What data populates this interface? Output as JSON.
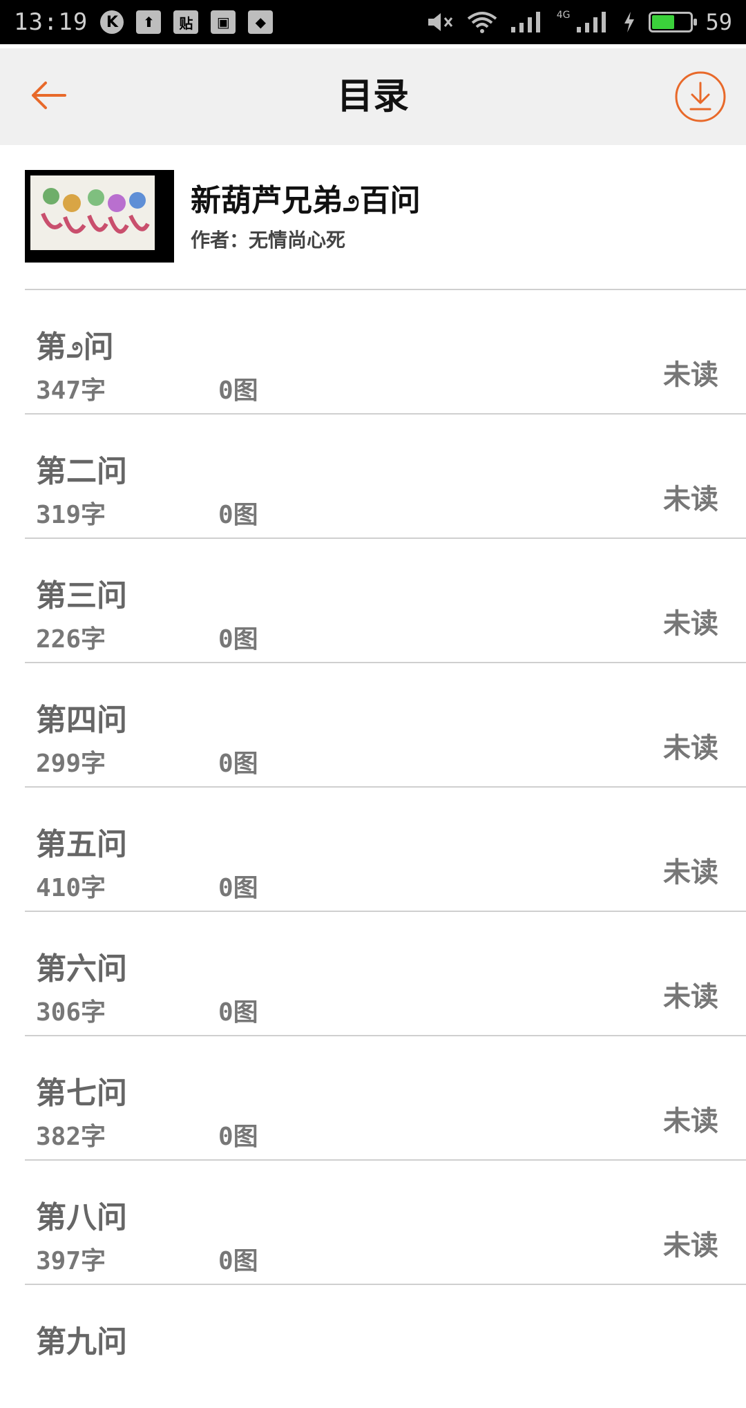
{
  "status_bar": {
    "time": "13:19",
    "icons": [
      "k-icon",
      "upload-icon",
      "tie-icon",
      "image-icon",
      "qq-icon",
      "mute-icon",
      "wifi-icon",
      "signal-icon",
      "signal-4g-icon",
      "charging-icon"
    ],
    "k_label": "K",
    "tie_label": "贴",
    "network_label": "4G",
    "battery_level": 59,
    "battery_text": "59"
  },
  "header": {
    "title": "目录",
    "accent_color": "#e8692a"
  },
  "book": {
    "title": "新葫芦兄弟೨百问",
    "author": "作者：无情尚心死"
  },
  "chapters": [
    {
      "title": "第೨问",
      "words": "347字",
      "images": "0图",
      "status": "未读"
    },
    {
      "title": "第二问",
      "words": "319字",
      "images": "0图",
      "status": "未读"
    },
    {
      "title": "第三问",
      "words": "226字",
      "images": "0图",
      "status": "未读"
    },
    {
      "title": "第四问",
      "words": "299字",
      "images": "0图",
      "status": "未读"
    },
    {
      "title": "第五问",
      "words": "410字",
      "images": "0图",
      "status": "未读"
    },
    {
      "title": "第六问",
      "words": "306字",
      "images": "0图",
      "status": "未读"
    },
    {
      "title": "第七问",
      "words": "382字",
      "images": "0图",
      "status": "未读"
    },
    {
      "title": "第八问",
      "words": "397字",
      "images": "0图",
      "status": "未读"
    },
    {
      "title": "第九问",
      "words": "",
      "images": "",
      "status": ""
    }
  ]
}
